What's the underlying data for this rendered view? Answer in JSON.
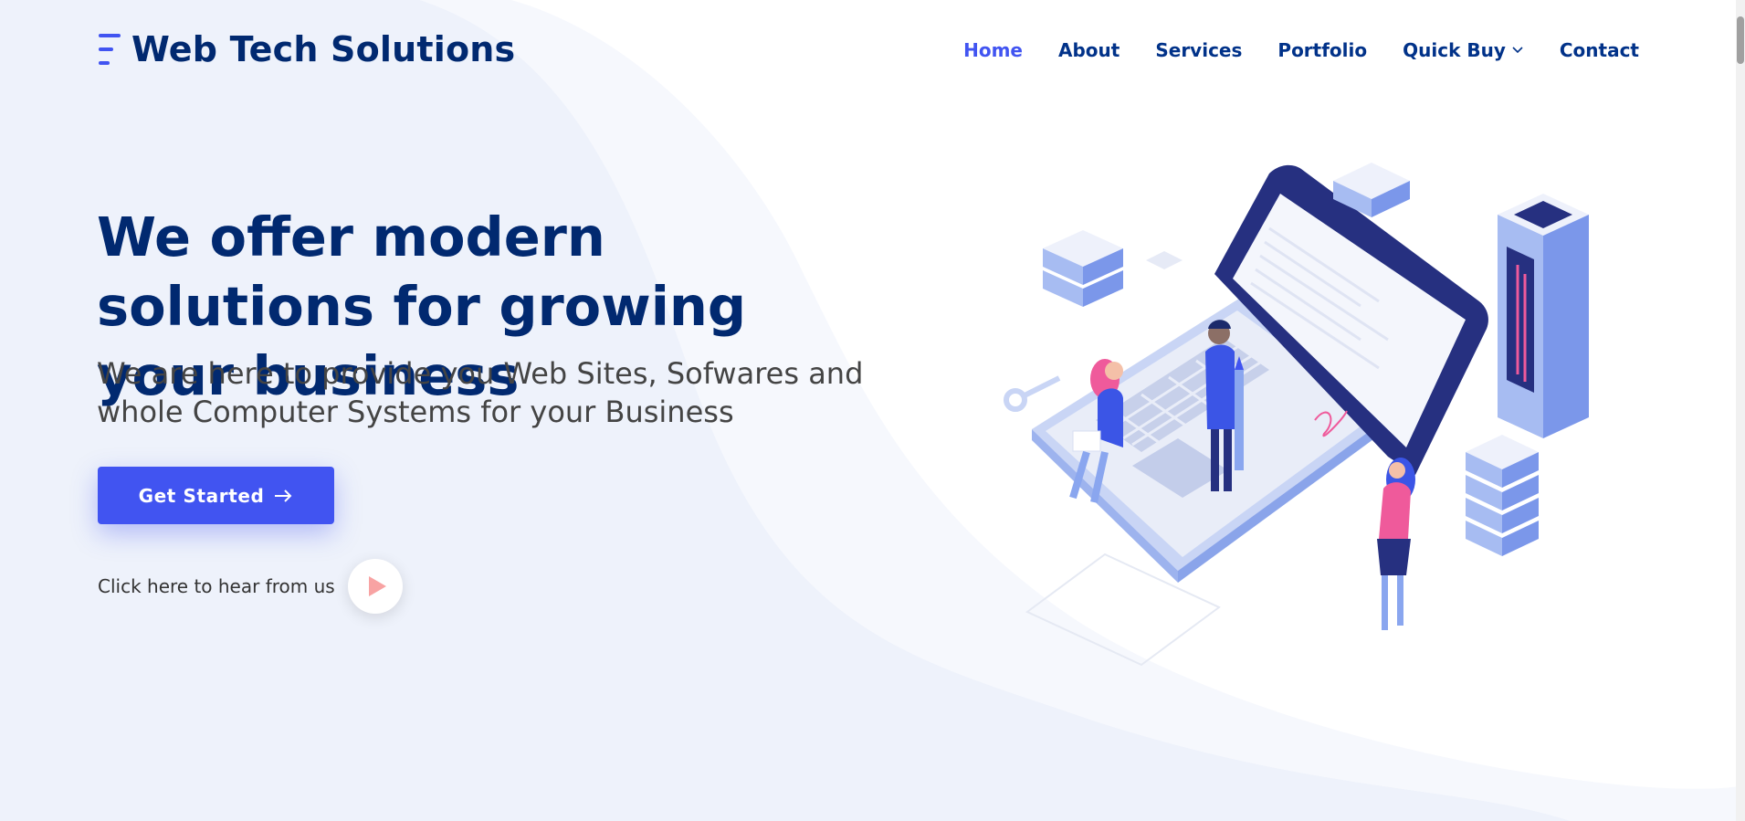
{
  "brand": {
    "name": "Web Tech Solutions",
    "icon": "logo-bars-icon",
    "accent": "#4154f1",
    "dark": "#012970"
  },
  "nav": {
    "items": [
      {
        "label": "Home",
        "active": true
      },
      {
        "label": "About"
      },
      {
        "label": "Services"
      },
      {
        "label": "Portfolio"
      },
      {
        "label": "Quick Buy",
        "dropdown": true
      },
      {
        "label": "Contact"
      }
    ]
  },
  "hero": {
    "title": "We offer modern solutions for growing your business",
    "subtitle": "We are here to provide you Web Sites, Sofwares and whole Computer Systems for your Business",
    "cta_label": "Get Started",
    "cta_icon": "arrow-right-icon",
    "hear_text": "Click here to hear from us",
    "play_icon": "play-icon"
  },
  "colors": {
    "primary_button": "#4154f1",
    "play_icon": "#f8a3a3"
  }
}
